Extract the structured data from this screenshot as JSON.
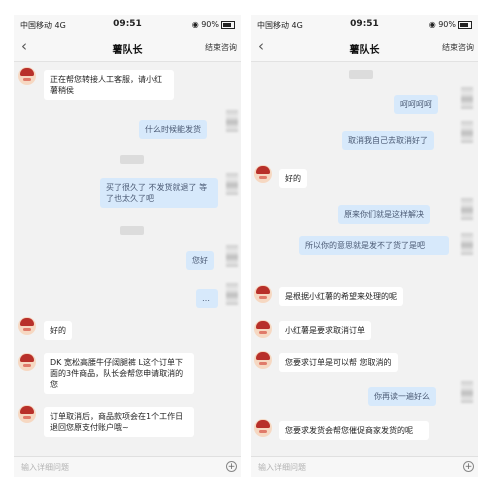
{
  "status": {
    "carrier": "中国移动",
    "network": "4G",
    "time": "09:51",
    "battery": "90%"
  },
  "header": {
    "title": "薯队长",
    "action": "结束咨询"
  },
  "input": {
    "placeholder": "输入详细问题"
  },
  "left_messages": [
    "正在帮您转接人工客服，请小红薯稍侯",
    "什么时候能发货",
    "买了很久了 不发货就退了 等了也太久了吧",
    "您好",
    "…",
    "好的",
    "DK 宽松高腰牛仔阔腿裤 L这个订单下面的3件商品，队长会帮您申请取消的您",
    "订单取消后，商品款项会在1个工作日退回您原支付账户哦~"
  ],
  "right_messages": [
    "呵呵呵呵",
    "取消我自己去取消好了",
    "好的",
    "原来你们就是这样解决",
    "所以你的意思就是发不了货了是吧",
    "是根据小红薯的希望来处理的呢",
    "小红薯是要求取消订单",
    "您要求订单是可以帮 您取消的",
    "你再读一遍好么",
    "您要求发货会帮您催促商家发货的呢"
  ]
}
